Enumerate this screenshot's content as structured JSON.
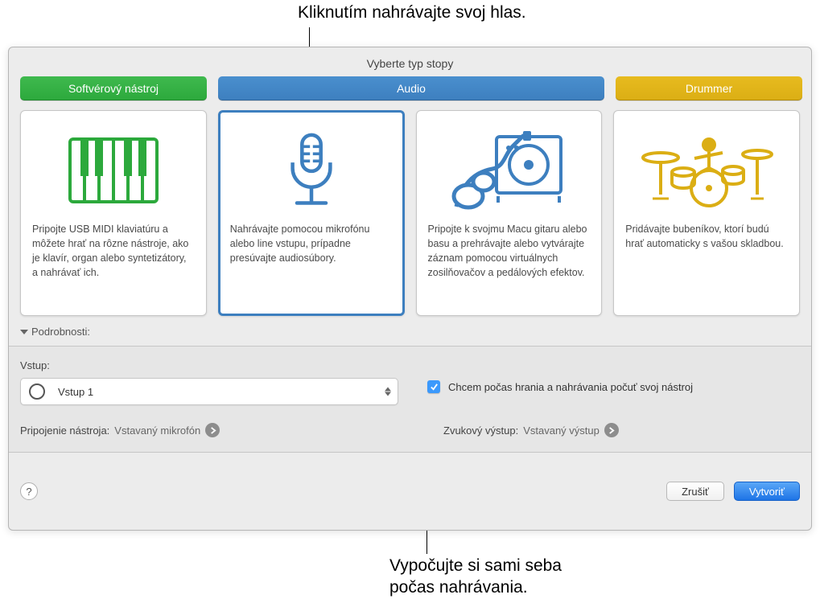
{
  "callouts": {
    "top": "Kliknutím nahrávajte svoj hlas.",
    "bottom_line1": "Vypočujte si sami seba",
    "bottom_line2": "počas nahrávania."
  },
  "panel_title": "Vyberte typ stopy",
  "tabs": {
    "software_instrument": "Softvérový nástroj",
    "audio": "Audio",
    "drummer": "Drummer"
  },
  "cards": {
    "keyboard": "Pripojte USB MIDI klaviatúru a môžete hrať na rôzne nástroje, ako je klavír, organ alebo syntetizátory, a nahrávať ich.",
    "mic": "Nahrávajte pomocou mikrofónu alebo line vstupu, prípadne presúvajte audiosúbory.",
    "guitar": "Pripojte k svojmu Macu gitaru alebo basu a prehrávajte alebo vytvárajte záznam pomocou virtuálnych zosilňovačov a pedálových efektov.",
    "drums": "Pridávajte bubeníkov, ktorí budú hrať automaticky s vašou skladbou."
  },
  "details_label": "Podrobnosti:",
  "input": {
    "label": "Vstup:",
    "value": "Vstup 1"
  },
  "monitor_checkbox": "Chcem počas hrania a nahrávania počuť svoj nástroj",
  "connection": {
    "instrument_label": "Pripojenie nástroja:",
    "instrument_value": "Vstavaný mikrofón",
    "output_label": "Zvukový výstup:",
    "output_value": "Vstavaný výstup"
  },
  "buttons": {
    "help": "?",
    "cancel": "Zrušiť",
    "create": "Vytvoriť"
  }
}
